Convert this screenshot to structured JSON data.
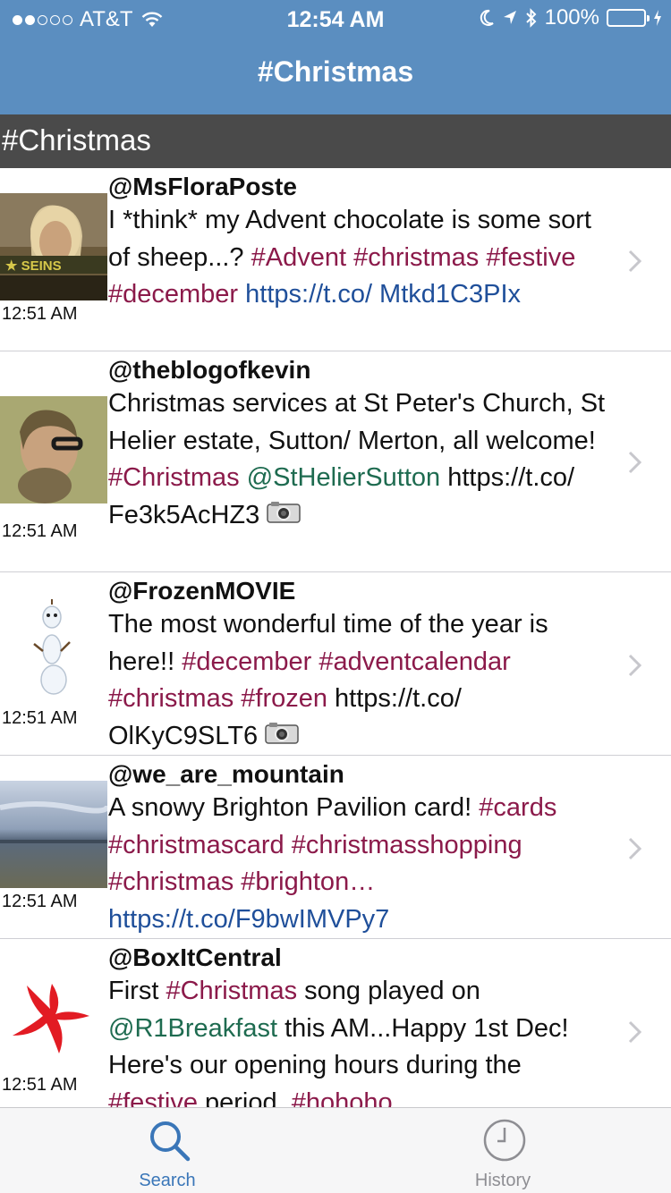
{
  "status_bar": {
    "carrier": "AT&T",
    "time": "12:54 AM",
    "battery": "100%"
  },
  "nav": {
    "title": "#Christmas"
  },
  "section_header": "#Christmas",
  "tweets": [
    {
      "handle": "@MsFloraPoste",
      "time": "12:51 AM",
      "parts": [
        {
          "t": "text",
          "v": "I *think* my Advent chocolate is some sort of sheep...? "
        },
        {
          "t": "tag",
          "v": "#Advent"
        },
        {
          "t": "text",
          "v": " "
        },
        {
          "t": "tag",
          "v": "#christmas"
        },
        {
          "t": "text",
          "v": " "
        },
        {
          "t": "tag",
          "v": "#festive"
        },
        {
          "t": "text",
          "v": " "
        },
        {
          "t": "tag",
          "v": "#december"
        },
        {
          "t": "text",
          "v": " "
        },
        {
          "t": "link",
          "v": "https://t.co/ Mtkd1C3PIx"
        }
      ]
    },
    {
      "handle": "@theblogofkevin",
      "time": "12:51 AM",
      "parts": [
        {
          "t": "text",
          "v": "Christmas services at St Peter's Church, St Helier estate, Sutton/ Merton, all welcome! "
        },
        {
          "t": "tag",
          "v": "#Christmas"
        },
        {
          "t": "text",
          "v": " "
        },
        {
          "t": "mention",
          "v": "@StHelierSutton"
        },
        {
          "t": "text",
          "v": " https://t.co/ Fe3k5AcHZ3 "
        },
        {
          "t": "camera",
          "v": "camera-icon"
        }
      ]
    },
    {
      "handle": "@FrozenMOVIE",
      "time": "12:51 AM",
      "parts": [
        {
          "t": "text",
          "v": "The most wonderful time of the year is here!! "
        },
        {
          "t": "tag",
          "v": "#december"
        },
        {
          "t": "text",
          "v": " "
        },
        {
          "t": "tag",
          "v": "#adventcalendar"
        },
        {
          "t": "text",
          "v": " "
        },
        {
          "t": "tag",
          "v": "#christmas"
        },
        {
          "t": "text",
          "v": " "
        },
        {
          "t": "tag",
          "v": "#frozen"
        },
        {
          "t": "text",
          "v": " https://t.co/ OlKyC9SLT6 "
        },
        {
          "t": "camera",
          "v": "camera-icon"
        }
      ]
    },
    {
      "handle": "@we_are_mountain",
      "time": "12:51 AM",
      "parts": [
        {
          "t": "text",
          "v": "A snowy Brighton Pavilion card! "
        },
        {
          "t": "tag",
          "v": "#cards"
        },
        {
          "t": "text",
          "v": " "
        },
        {
          "t": "tag",
          "v": "#christmascard"
        },
        {
          "t": "text",
          "v": " "
        },
        {
          "t": "tag",
          "v": "#christmasshopping"
        },
        {
          "t": "text",
          "v": " "
        },
        {
          "t": "tag",
          "v": "#christmas"
        },
        {
          "t": "text",
          "v": " "
        },
        {
          "t": "tag",
          "v": "#brighton…"
        },
        {
          "t": "text",
          "v": " "
        },
        {
          "t": "link",
          "v": "https://t.co/F9bwIMVPy7"
        }
      ]
    },
    {
      "handle": "@BoxItCentral",
      "time": "12:51 AM",
      "parts": [
        {
          "t": "text",
          "v": "First "
        },
        {
          "t": "tag",
          "v": "#Christmas"
        },
        {
          "t": "text",
          "v": " song played on "
        },
        {
          "t": "mention",
          "v": "@R1Breakfast"
        },
        {
          "t": "text",
          "v": " this AM...Happy 1st Dec! Here's our opening hours during the "
        },
        {
          "t": "tag",
          "v": "#festive"
        },
        {
          "t": "text",
          "v": " period. "
        },
        {
          "t": "tag",
          "v": "#hohoho"
        }
      ]
    }
  ],
  "tabs": [
    {
      "label": "Search",
      "icon": "search-icon",
      "active": true
    },
    {
      "label": "History",
      "icon": "clock-icon",
      "active": false
    }
  ],
  "colors": {
    "nav": "#5b8ec0",
    "section": "#4a4a4a",
    "hashtag": "#8b1a4a",
    "mention": "#1e6b50",
    "link": "#1f4f9a",
    "tab_active": "#3a76b8",
    "tab_inactive": "#8e8e93"
  }
}
